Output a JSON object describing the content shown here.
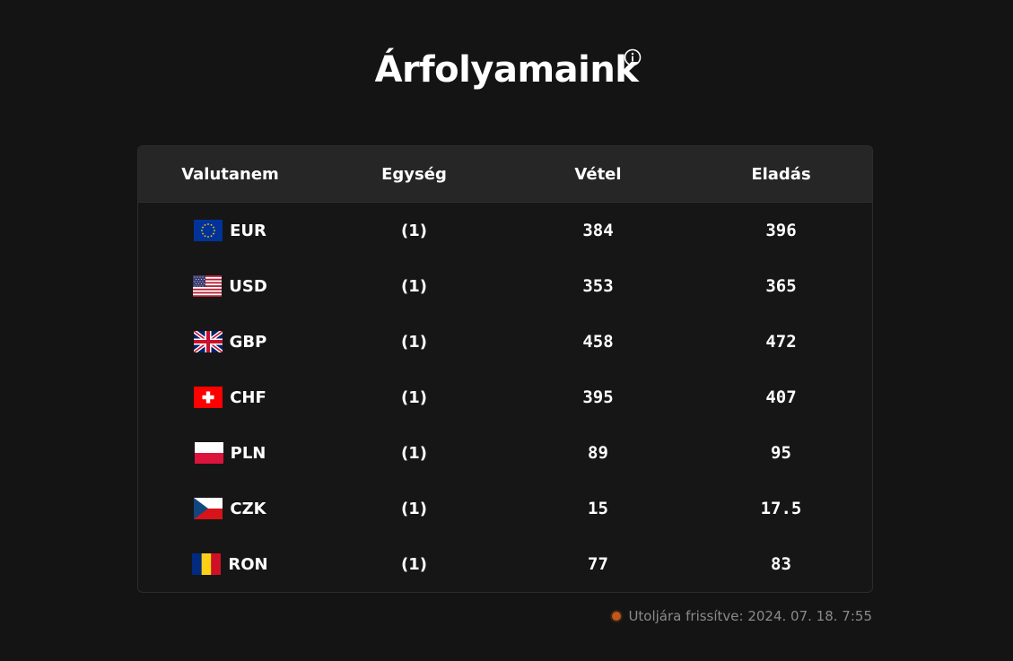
{
  "page": {
    "title": "Árfolyamaink",
    "info_icon": "info-icon"
  },
  "table": {
    "headers": [
      "Valutanem",
      "Egység",
      "Vétel",
      "Eladás"
    ],
    "rows": [
      {
        "code": "EUR",
        "flag": "eu-flag-icon",
        "unit": "(1)",
        "buy": "384",
        "sell": "396"
      },
      {
        "code": "USD",
        "flag": "us-flag-icon",
        "unit": "(1)",
        "buy": "353",
        "sell": "365"
      },
      {
        "code": "GBP",
        "flag": "uk-flag-icon",
        "unit": "(1)",
        "buy": "458",
        "sell": "472"
      },
      {
        "code": "CHF",
        "flag": "swiss-flag-icon",
        "unit": "(1)",
        "buy": "395",
        "sell": "407"
      },
      {
        "code": "PLN",
        "flag": "poland-flag-icon",
        "unit": "(1)",
        "buy": "89",
        "sell": "95"
      },
      {
        "code": "CZK",
        "flag": "czech-flag-icon",
        "unit": "(1)",
        "buy": "15",
        "sell": "17.5"
      },
      {
        "code": "RON",
        "flag": "romania-flag-icon",
        "unit": "(1)",
        "buy": "77",
        "sell": "83"
      }
    ]
  },
  "footer": {
    "updated_text": "Utoljára frissítve: 2024. 07. 18. 7:55",
    "status_color": "#c0571b"
  },
  "colors": {
    "background": "#141414",
    "header_bg": "#262626",
    "text": "#ffffff",
    "muted": "#8a8a8a"
  }
}
